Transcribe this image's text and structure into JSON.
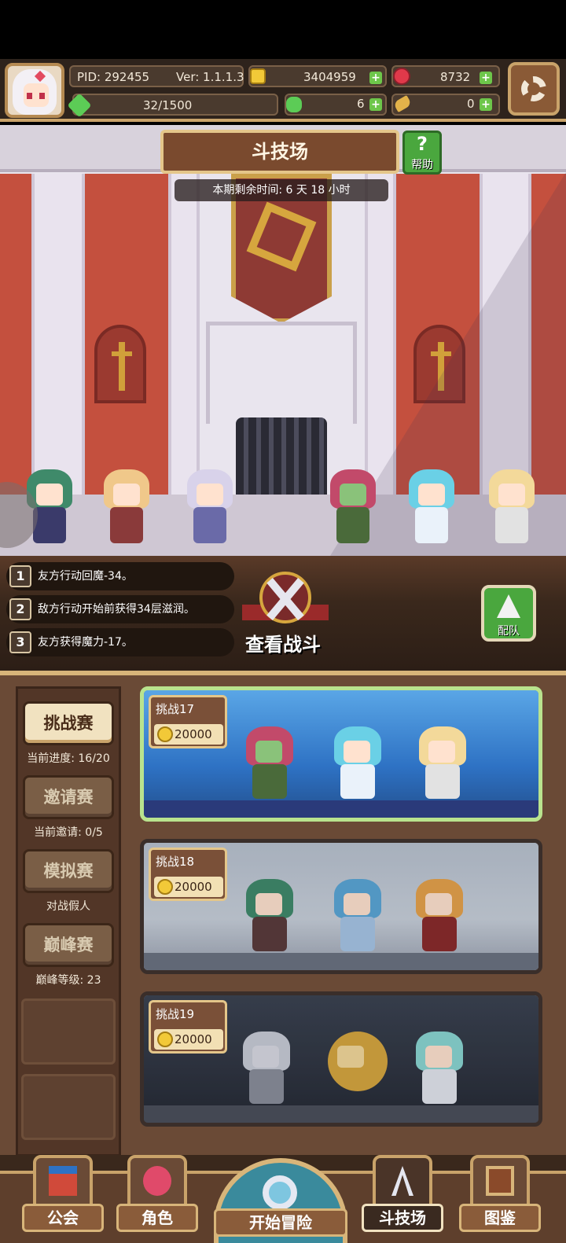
{
  "header": {
    "pid": "PID: 292455",
    "version": "Ver: 1.1.1.3",
    "gold": "3404959",
    "gems": "8732",
    "stamina": "32/1500",
    "clover": "6",
    "horn": "0"
  },
  "arena": {
    "title": "斗技场",
    "help_label": "帮助",
    "help_glyph": "?",
    "timer": "本期剩余时间: 6 天 18 小时"
  },
  "battle": {
    "buffs": [
      {
        "num": "1",
        "text": "友方行动回魔-34。"
      },
      {
        "num": "2",
        "text": "敌方行动开始前获得34层滋润。"
      },
      {
        "num": "3",
        "text": "友方获得魔力-17。"
      }
    ],
    "view_label": "查看战斗",
    "team_label": "配队"
  },
  "modes": [
    {
      "label": "挑战赛",
      "sub": "当前进度: 16/20"
    },
    {
      "label": "邀请赛",
      "sub": "当前邀请: 0/5"
    },
    {
      "label": "模拟赛",
      "sub": "对战假人"
    },
    {
      "label": "巅峰赛",
      "sub": "巅峰等级: 23"
    }
  ],
  "challenges": [
    {
      "name": "挑战17",
      "reward": "20000"
    },
    {
      "name": "挑战18",
      "reward": "20000"
    },
    {
      "name": "挑战19",
      "reward": "20000"
    }
  ],
  "nav": {
    "guild": "公会",
    "role": "角色",
    "adventure": "开始冒险",
    "arena": "斗技场",
    "codex": "图鉴"
  },
  "colors": {
    "accent_gold": "#c9a36a",
    "panel_brown": "#6a4a36",
    "active_green": "#b9e38e",
    "help_green": "#4aa73e"
  },
  "icons": {
    "settings": "gear-icon",
    "gold": "coin-icon",
    "gems": "gem-icon",
    "stamina": "bolt-icon",
    "clover": "clover-icon",
    "horn": "horn-icon"
  }
}
